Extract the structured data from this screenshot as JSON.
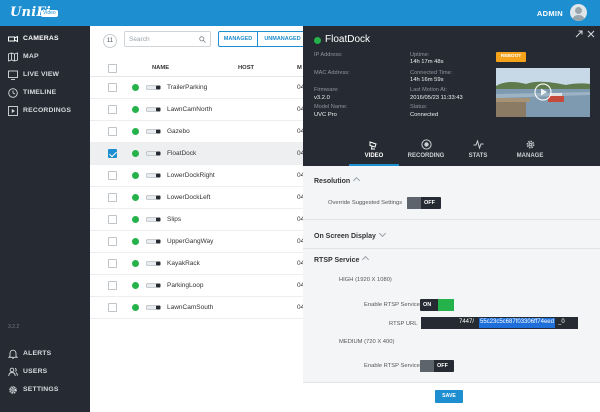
{
  "app": {
    "logo": "UniFi",
    "logo_badge": "Video",
    "user": "ADMIN"
  },
  "sidebar": {
    "items": [
      {
        "label": "CAMERAS",
        "icon": "camera-icon"
      },
      {
        "label": "MAP",
        "icon": "map-icon"
      },
      {
        "label": "LIVE VIEW",
        "icon": "live-view-icon"
      },
      {
        "label": "TIMELINE",
        "icon": "clock-icon"
      },
      {
        "label": "RECORDINGS",
        "icon": "play-icon"
      }
    ],
    "bottom_items": [
      {
        "label": "ALERTS",
        "icon": "bell-icon"
      },
      {
        "label": "USERS",
        "icon": "users-icon"
      },
      {
        "label": "SETTINGS",
        "icon": "gear-icon"
      }
    ],
    "version": "3.2.2"
  },
  "list": {
    "count": "11",
    "search_placeholder": "Search",
    "filters": [
      "MANAGED",
      "UNMANAGED"
    ],
    "columns": [
      "NAME",
      "HOST",
      "M"
    ],
    "rows": [
      {
        "name": "TrailerParking",
        "mac": "04"
      },
      {
        "name": "LawnCamNorth",
        "mac": "04"
      },
      {
        "name": "Gazebo",
        "mac": "04"
      },
      {
        "name": "FloatDock",
        "mac": "04",
        "selected": true
      },
      {
        "name": "LowerDockRight",
        "mac": "04"
      },
      {
        "name": "LowerDockLeft",
        "mac": "04"
      },
      {
        "name": "Slips",
        "mac": "04"
      },
      {
        "name": "UpperGangWay",
        "mac": "04"
      },
      {
        "name": "KayakRack",
        "mac": "04"
      },
      {
        "name": "ParkingLoop",
        "mac": "04"
      },
      {
        "name": "LawnCamSouth",
        "mac": "04"
      }
    ]
  },
  "detail": {
    "title": "FloatDock",
    "info": {
      "ip_label": "IP Address:",
      "mac_label": "MAC Address:",
      "firmware_label": "Firmware:",
      "firmware": "v3.2.0",
      "model_label": "Model Name:",
      "model": "UVC Pro",
      "uptime_label": "Uptime:",
      "uptime": "14h 17m 48s",
      "connected_label": "Connected Time:",
      "connected": "14h 16m 59s",
      "motion_label": "Last Motion At:",
      "motion": "2016/05/23 11:33:43",
      "status_label": "Status:",
      "status": "Connected"
    },
    "reboot_label": "REBOOT",
    "tabs": [
      "VIDEO",
      "RECORDING",
      "STATS",
      "MANAGE"
    ],
    "resolution": {
      "title": "Resolution",
      "override_label": "Override Suggested Settings",
      "override_state": "OFF"
    },
    "osd_title": "On Screen Display",
    "rtsp": {
      "title": "RTSP Service",
      "high_label": "HIGH (1920 X 1080)",
      "enable_label": "Enable RTSP Service",
      "high_state": "ON",
      "url_label": "RTSP URL",
      "url_prefix": "7447/",
      "url_highlight": "55c23c5c687f03306ff74eed",
      "url_suffix": "_0",
      "medium_label": "MEDIUM (720 X 400)",
      "medium_enable_label": "Enable RTSP Service",
      "medium_state": "OFF"
    },
    "save_label": "SAVE"
  },
  "colors": {
    "brand_blue": "#1d8ecf",
    "sidebar_dark": "#262b33",
    "status_green": "#25b24a",
    "reboot_orange": "#f6a21b"
  }
}
